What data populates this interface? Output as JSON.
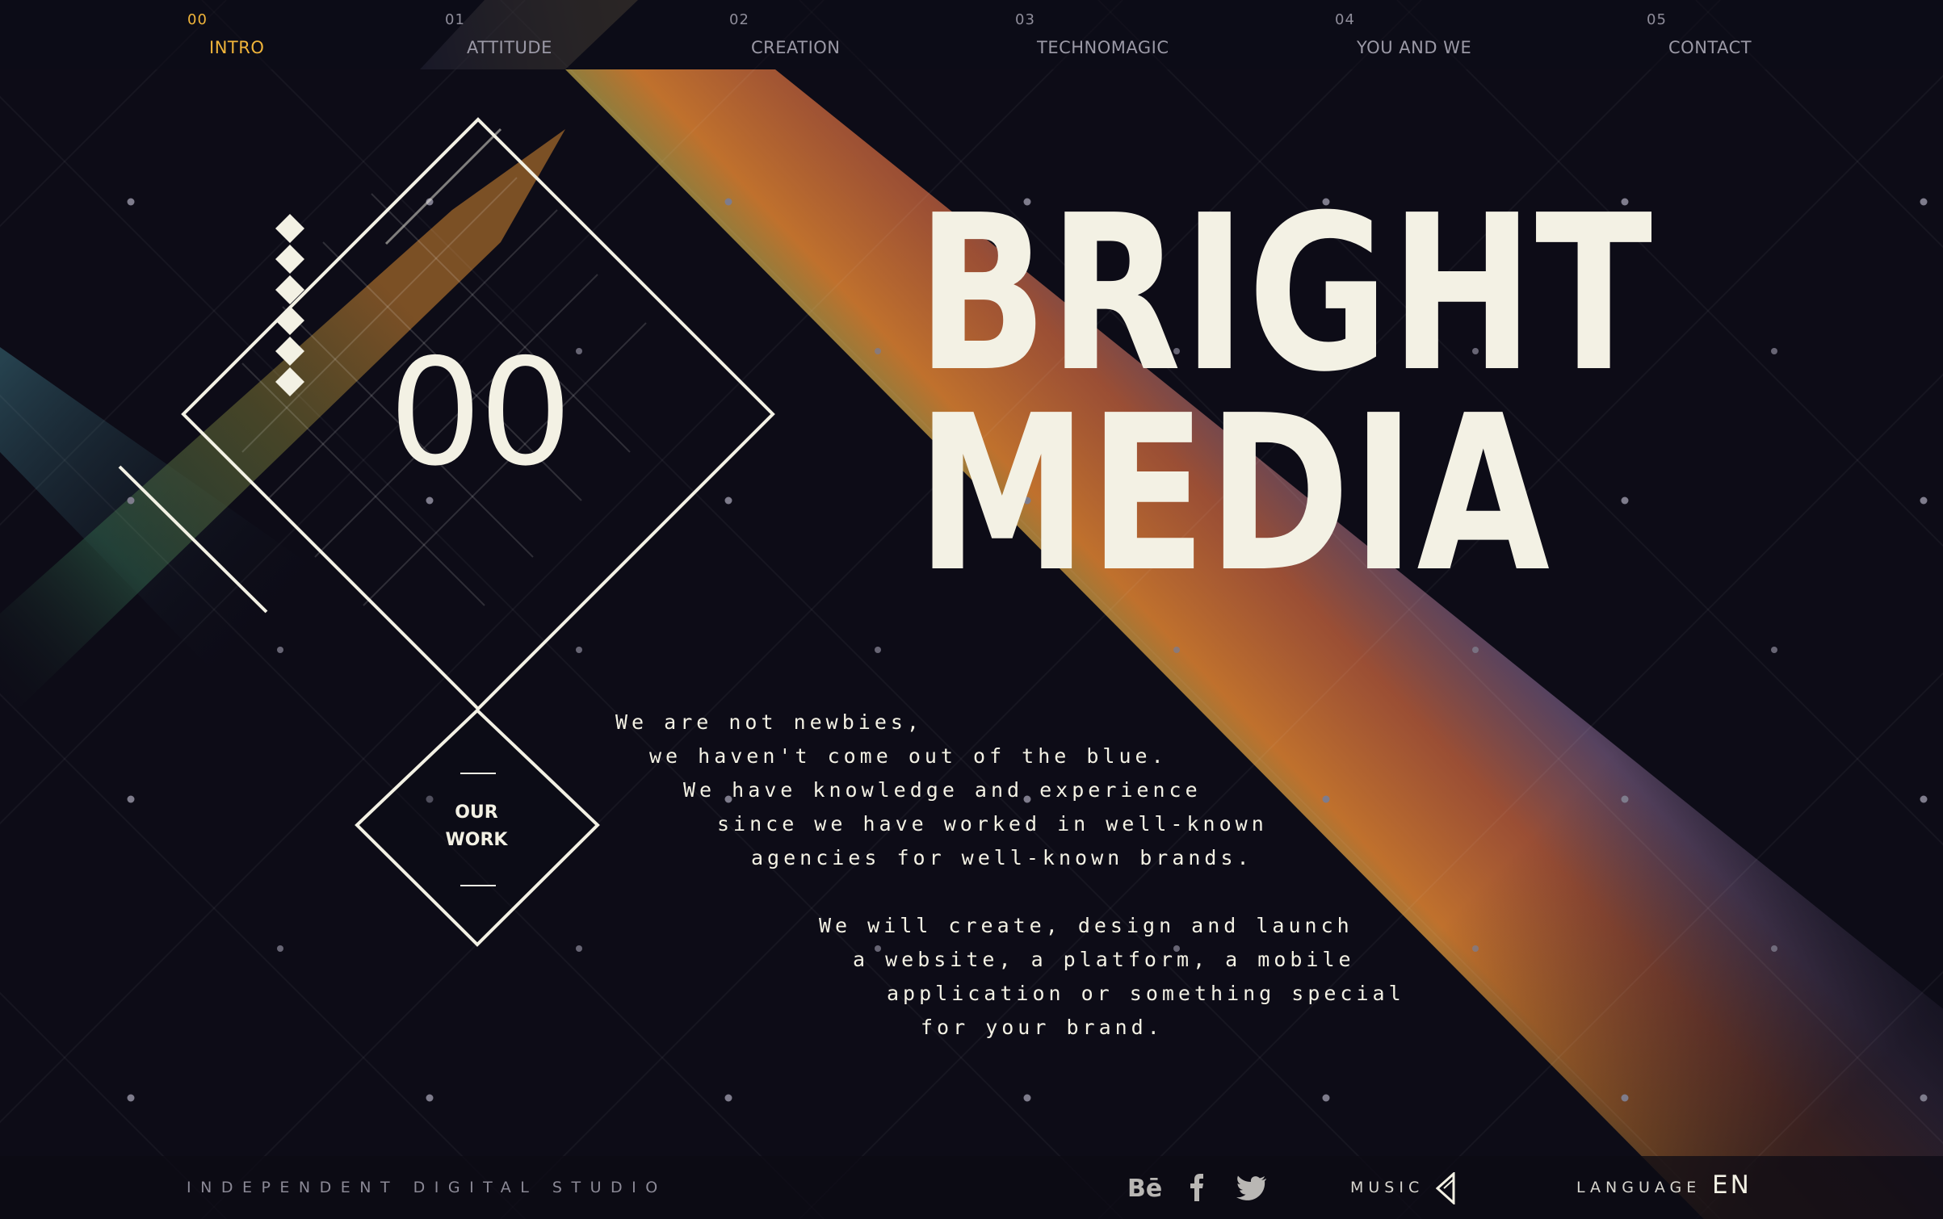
{
  "nav": {
    "items": [
      {
        "num": "00",
        "label": "INTRO"
      },
      {
        "num": "01",
        "label": "ATTITUDE"
      },
      {
        "num": "02",
        "label": "CREATION"
      },
      {
        "num": "03",
        "label": "TECHNOMAGIC"
      },
      {
        "num": "04",
        "label": "YOU AND WE"
      },
      {
        "num": "05",
        "label": "CONTACT"
      }
    ],
    "active_index": 0
  },
  "intro": {
    "section_number": "00",
    "our_work_label": "OUR\nWORK"
  },
  "headline": {
    "line1": "BRIGHT",
    "line2": "MEDIA"
  },
  "copy": {
    "paragraph1": [
      "We are not newbies,",
      "we haven't come out of the blue.",
      "We have knowledge and experience",
      "since we have worked in well-known",
      "agencies for well-known brands."
    ],
    "paragraph2": [
      "We will create, design and launch",
      "a website, a platform, a mobile",
      "application or something special",
      "for your brand."
    ]
  },
  "footer": {
    "tagline": "INDEPENDENT DIGITAL STUDIO",
    "social_icons": [
      "behance-icon",
      "facebook-icon",
      "twitter-icon"
    ],
    "music_label": "MUSIC",
    "music_icon": "speaker-triangle-icon",
    "language_label": "LANGUAGE",
    "language_value": "EN"
  },
  "colors": {
    "background": "#0d0c17",
    "text": "#f3f1e4",
    "accent": "#f0b43a",
    "muted": "#9b99a6"
  }
}
